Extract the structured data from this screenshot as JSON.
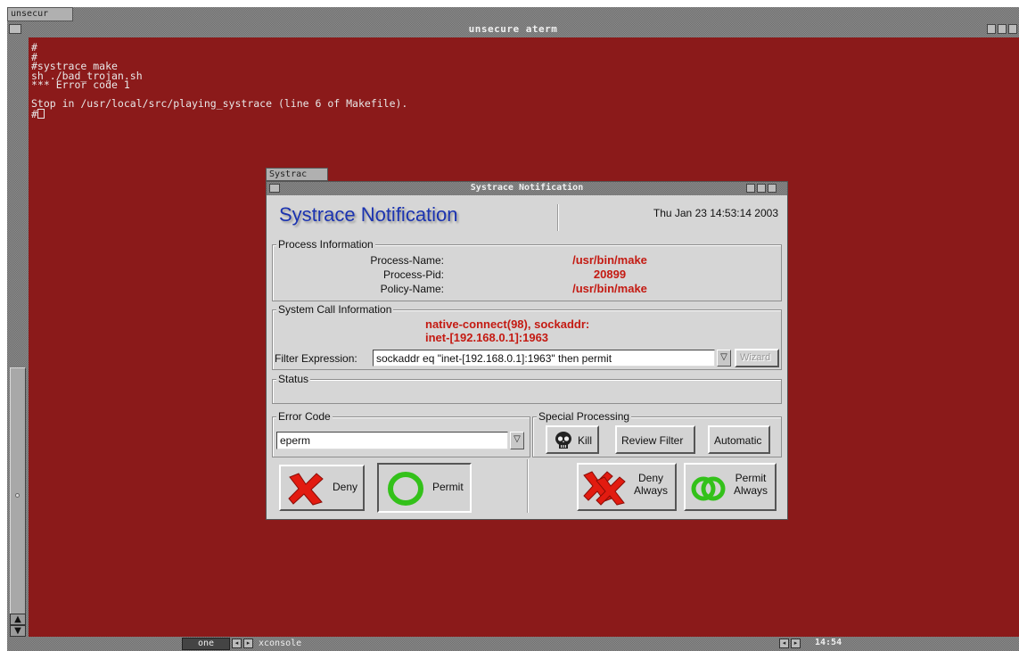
{
  "top_tab": {
    "label": "unsecur"
  },
  "aterm": {
    "title": "unsecure aterm",
    "terminal_lines": "#\n#\n#systrace make\nsh ./bad_trojan.sh\n*** Error code 1\n\nStop in /usr/local/src/playing_systrace (line 6 of Makefile).\n#"
  },
  "taskbar": {
    "desktop": "one",
    "task": "xconsole",
    "clock": "14:54"
  },
  "dialog": {
    "icon_tab": "Systrac",
    "window_title": "Systrace Notification",
    "heading": "Systrace Notification",
    "date": "Thu Jan 23 14:53:14 2003",
    "process": {
      "legend": "Process Information",
      "name_label": "Process-Name:",
      "name_value": "/usr/bin/make",
      "pid_label": "Process-Pid:",
      "pid_value": "20899",
      "policy_label": "Policy-Name:",
      "policy_value": "/usr/bin/make"
    },
    "syscall": {
      "legend": "System Call Information",
      "line1": "native-connect(98), sockaddr:",
      "line2": "inet-[192.168.0.1]:1963",
      "filter_label": "Filter Expression:",
      "filter_value": "sockaddr eq \"inet-[192.168.0.1]:1963\" then permit",
      "wizard": "Wizard"
    },
    "status": {
      "legend": "Status"
    },
    "error_code": {
      "legend": "Error Code",
      "value": "eperm"
    },
    "special": {
      "legend": "Special Processing",
      "kill": "Kill",
      "review": "Review Filter",
      "automatic": "Automatic"
    },
    "actions": {
      "deny": "Deny",
      "permit": "Permit",
      "deny_always_1": "Deny",
      "deny_always_2": "Always",
      "permit_always_1": "Permit",
      "permit_always_2": "Always"
    }
  },
  "colors": {
    "terminal_bg": "#8b1a1a",
    "heading_blue": "#1b33b0",
    "value_red": "#c41a12",
    "permit_green": "#33c11a",
    "deny_red": "#e21b10"
  }
}
